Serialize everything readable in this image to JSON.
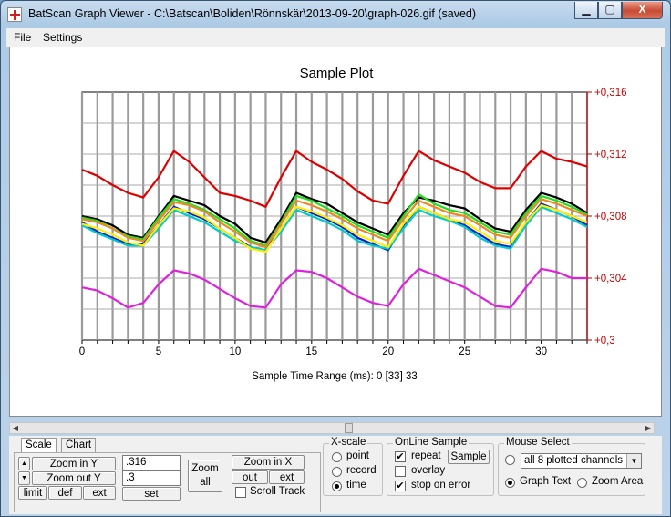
{
  "window": {
    "title": "BatScan Graph Viewer - C:\\Batscan\\Boliden\\Rönnskär\\2013-09-20\\graph-026.gif (saved)",
    "min": "▁",
    "max": "▢",
    "close": "X"
  },
  "menu": {
    "file": "File",
    "settings": "Settings"
  },
  "chart_data": {
    "type": "line",
    "title": "Sample Plot",
    "xlabel": "Sample Time Range (ms): 0  [33]  33",
    "xlim": [
      0,
      33
    ],
    "ylim": [
      0.3,
      0.316
    ],
    "xticks": [
      "0",
      "5",
      "10",
      "15",
      "20",
      "25",
      "30"
    ],
    "yticks": [
      "+0,3",
      "+0,304",
      "+0,308",
      "+0,312",
      "+0,316"
    ],
    "grid": true,
    "series": [
      {
        "color": "#dd0000",
        "values": [
          0.311,
          0.3106,
          0.31,
          0.3095,
          0.3092,
          0.3105,
          0.3122,
          0.3115,
          0.3105,
          0.3095,
          0.3093,
          0.309,
          0.3086,
          0.3105,
          0.3122,
          0.3115,
          0.311,
          0.3104,
          0.3096,
          0.309,
          0.3088,
          0.3106,
          0.3122,
          0.3116,
          0.3112,
          0.3108,
          0.3102,
          0.3098,
          0.3098,
          0.3112,
          0.3122,
          0.3117,
          0.3115,
          0.3112
        ]
      },
      {
        "color": "#000000",
        "values": [
          0.308,
          0.3078,
          0.3074,
          0.3068,
          0.3066,
          0.308,
          0.3093,
          0.309,
          0.3087,
          0.308,
          0.3075,
          0.3066,
          0.3063,
          0.3078,
          0.3095,
          0.3091,
          0.3088,
          0.3082,
          0.3076,
          0.3072,
          0.3068,
          0.3082,
          0.3092,
          0.309,
          0.3087,
          0.3085,
          0.3078,
          0.3072,
          0.307,
          0.3084,
          0.3095,
          0.3092,
          0.3088,
          0.3082
        ]
      },
      {
        "color": "#22dd22",
        "values": [
          0.3079,
          0.3077,
          0.3072,
          0.3067,
          0.3065,
          0.3079,
          0.3091,
          0.3088,
          0.3084,
          0.3078,
          0.3072,
          0.3064,
          0.3061,
          0.3076,
          0.3093,
          0.309,
          0.3085,
          0.308,
          0.3074,
          0.307,
          0.3066,
          0.308,
          0.3094,
          0.3088,
          0.3084,
          0.3082,
          0.3076,
          0.307,
          0.3068,
          0.3082,
          0.3093,
          0.309,
          0.3086,
          0.3081
        ]
      },
      {
        "color": "#0022cc",
        "values": [
          0.3076,
          0.307,
          0.3066,
          0.3062,
          0.3062,
          0.3074,
          0.3086,
          0.3082,
          0.3078,
          0.3072,
          0.3066,
          0.306,
          0.3058,
          0.3072,
          0.3086,
          0.3082,
          0.3078,
          0.3073,
          0.3066,
          0.3062,
          0.3058,
          0.3074,
          0.3086,
          0.3082,
          0.3078,
          0.3074,
          0.3068,
          0.3062,
          0.306,
          0.3076,
          0.3088,
          0.3084,
          0.308,
          0.3074
        ]
      },
      {
        "color": "#00cccc",
        "values": [
          0.3074,
          0.3069,
          0.3065,
          0.3061,
          0.3061,
          0.3072,
          0.3084,
          0.308,
          0.3076,
          0.307,
          0.3064,
          0.306,
          0.3058,
          0.307,
          0.3084,
          0.308,
          0.3076,
          0.3071,
          0.3064,
          0.3061,
          0.3059,
          0.3072,
          0.3084,
          0.308,
          0.3077,
          0.3073,
          0.3066,
          0.3061,
          0.3059,
          0.3074,
          0.3086,
          0.3082,
          0.3078,
          0.3073
        ]
      },
      {
        "color": "#ee8822",
        "values": [
          0.3078,
          0.3076,
          0.3072,
          0.3066,
          0.3064,
          0.3077,
          0.3089,
          0.3087,
          0.3083,
          0.3076,
          0.307,
          0.3063,
          0.306,
          0.3075,
          0.309,
          0.3087,
          0.3083,
          0.3078,
          0.3072,
          0.3068,
          0.3064,
          0.3078,
          0.309,
          0.3086,
          0.3082,
          0.308,
          0.3074,
          0.3068,
          0.3066,
          0.308,
          0.3091,
          0.3088,
          0.3084,
          0.308
        ]
      },
      {
        "color": "#ffee00",
        "values": [
          0.3075,
          0.3072,
          0.3068,
          0.3063,
          0.3061,
          0.3074,
          0.3085,
          0.3083,
          0.3079,
          0.3072,
          0.3066,
          0.3059,
          0.3057,
          0.3072,
          0.3086,
          0.3083,
          0.3079,
          0.3074,
          0.3068,
          0.3064,
          0.306,
          0.3075,
          0.3086,
          0.3082,
          0.3078,
          0.3076,
          0.307,
          0.3064,
          0.3062,
          0.3076,
          0.3087,
          0.3084,
          0.308,
          0.3076
        ]
      },
      {
        "color": "#dd22dd",
        "values": [
          0.3034,
          0.3032,
          0.3027,
          0.3021,
          0.3024,
          0.3036,
          0.3045,
          0.3043,
          0.3039,
          0.3033,
          0.3027,
          0.3022,
          0.3021,
          0.3036,
          0.3045,
          0.3044,
          0.304,
          0.3034,
          0.3028,
          0.3024,
          0.3022,
          0.3036,
          0.3046,
          0.3042,
          0.3038,
          0.3034,
          0.3028,
          0.3022,
          0.3021,
          0.3034,
          0.3046,
          0.3044,
          0.304,
          0.304
        ]
      }
    ]
  },
  "tabs": {
    "scale": "Scale",
    "chart": "Chart"
  },
  "scale": {
    "zoom_in_y": "Zoom in Y",
    "zoom_out_y": "Zoom out Y",
    "up": "▲",
    "down": "▼",
    "limit": "limit",
    "def": "def",
    "ext": "ext",
    "max_value": ".316",
    "min_value": ".3",
    "set": "set",
    "zoom_all": "Zoom\nall",
    "zoom_in_x": "Zoom in X",
    "out": "out",
    "ext_x": "ext",
    "scroll_track": "Scroll Track"
  },
  "xscale": {
    "label": "X-scale",
    "point": "point",
    "record": "record",
    "time": "time"
  },
  "online": {
    "label": "OnLine Sample",
    "repeat": "repeat",
    "sample": "Sample",
    "overlay": "overlay",
    "stop_on_error": "stop on error"
  },
  "mouse": {
    "label": "Mouse Select",
    "channels": "all 8 plotted channels",
    "graph_text": "Graph Text",
    "zoom_area": "Zoom Area"
  }
}
